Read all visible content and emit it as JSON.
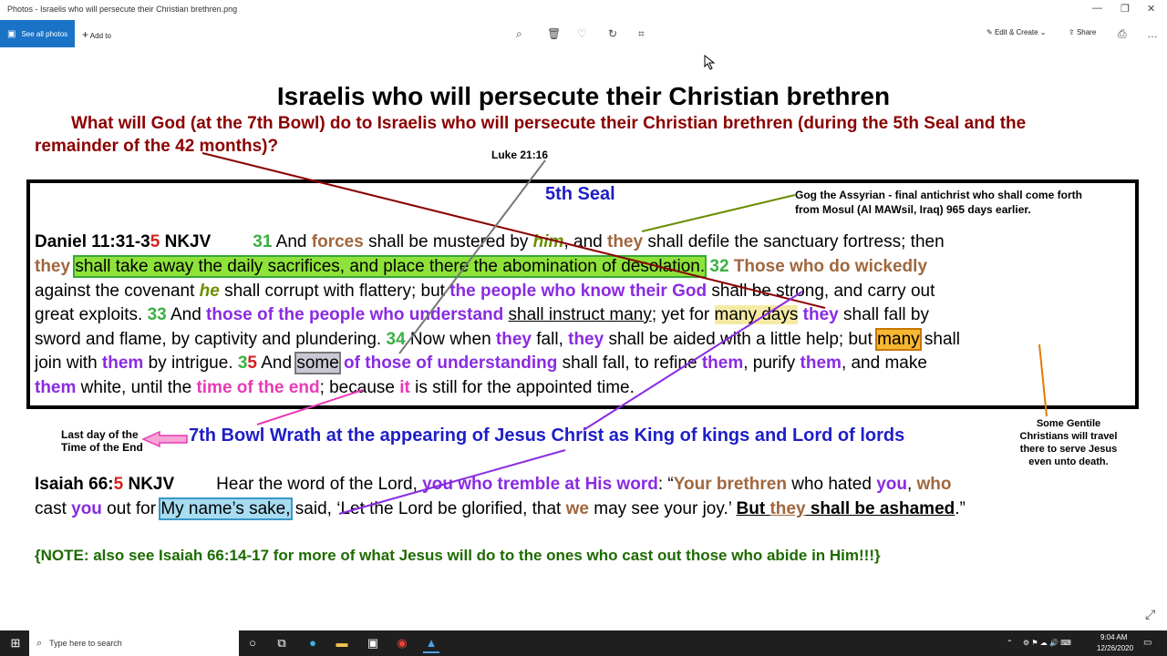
{
  "window": {
    "title": "Photos - Israelis who will persecute their Christian brethren.png",
    "controls": [
      "—",
      "❐",
      "✕"
    ]
  },
  "toolbar": {
    "see_all_label": "See all photos",
    "add_to_label": "Add to",
    "edit_create_label": "Edit & Create",
    "share_label": "Share",
    "icons": [
      "zoom-icon",
      "delete-icon",
      "heart-icon",
      "rotate-icon",
      "crop-icon",
      "print-icon",
      "more-icon"
    ]
  },
  "image": {
    "title": "Israelis who will persecute their Christian brethren",
    "question_1": "What will God (at the 7th Bowl) do to Israelis who will persecute their Christian brethren (during the 5th Seal and the",
    "question_2": "remainder of the 42 months)?",
    "luke_ref": "Luke 21:16",
    "seal_label": "5th Seal",
    "gog_note_1": "Gog the Assyrian - final antichrist who shall come forth",
    "gog_note_2": "from Mosul (Al MAWsil, Iraq) 965 days earlier.",
    "daniel": {
      "ref_a": "Daniel 11:31-3",
      "ref_b": "5",
      "ref_c": " NKJV",
      "line1": [
        {
          "t": "31",
          "c": "green"
        },
        {
          "t": " And ",
          "c": ""
        },
        {
          "t": "forces",
          "c": "tan"
        },
        {
          "t": " shall be mustered by ",
          "c": ""
        },
        {
          "t": "him",
          "c": "olive"
        },
        {
          "t": ", and ",
          "c": ""
        },
        {
          "t": "they",
          "c": "tan"
        },
        {
          "t": " shall defile the sanctuary fortress; then",
          "c": ""
        }
      ],
      "line2": [
        {
          "t": "they",
          "c": "tan"
        },
        {
          "t": " ",
          "c": ""
        },
        {
          "t": "shall take away the daily sacrifices, and place there the abomination of desolation.",
          "c": "hl-green"
        },
        {
          "t": " 32",
          "c": "green"
        },
        {
          "t": " Those who do wickedly",
          "c": "tan"
        }
      ],
      "line3": [
        {
          "t": "against the covenant ",
          "c": ""
        },
        {
          "t": "he",
          "c": "olive"
        },
        {
          "t": " shall corrupt with flattery; but ",
          "c": ""
        },
        {
          "t": "the people who know their God",
          "c": "purple"
        },
        {
          "t": " shall be strong, and carry out",
          "c": ""
        }
      ],
      "line4": [
        {
          "t": "great exploits. ",
          "c": ""
        },
        {
          "t": "33",
          "c": "green"
        },
        {
          "t": " And ",
          "c": ""
        },
        {
          "t": "those of the people who understand",
          "c": "purple"
        },
        {
          "t": " ",
          "c": ""
        },
        {
          "t": "shall instruct many",
          "c": "ul"
        },
        {
          "t": "; yet for ",
          "c": ""
        },
        {
          "t": "many days",
          "c": "hl-yellow"
        },
        {
          "t": " ",
          "c": ""
        },
        {
          "t": "they",
          "c": "purple"
        },
        {
          "t": " shall fall by",
          "c": ""
        }
      ],
      "line5": [
        {
          "t": "sword and flame, by captivity and plundering. ",
          "c": ""
        },
        {
          "t": "34",
          "c": "green"
        },
        {
          "t": " Now when ",
          "c": ""
        },
        {
          "t": "they",
          "c": "purple"
        },
        {
          "t": " fall, ",
          "c": ""
        },
        {
          "t": "they",
          "c": "purple"
        },
        {
          "t": " shall be aided with a little help; but ",
          "c": ""
        },
        {
          "t": "many",
          "c": "hl-orange"
        },
        {
          "t": " shall",
          "c": ""
        }
      ],
      "line6": [
        {
          "t": "join with ",
          "c": ""
        },
        {
          "t": "them",
          "c": "purple"
        },
        {
          "t": " by intrigue. ",
          "c": ""
        },
        {
          "t": "3",
          "c": "green"
        },
        {
          "t": "5",
          "c": "red"
        },
        {
          "t": " And ",
          "c": ""
        },
        {
          "t": "some",
          "c": "hl-gray"
        },
        {
          "t": " of those of understanding",
          "c": "purple"
        },
        {
          "t": " shall fall, to refine ",
          "c": ""
        },
        {
          "t": "them",
          "c": "purple"
        },
        {
          "t": ", purify ",
          "c": ""
        },
        {
          "t": "them",
          "c": "purple"
        },
        {
          "t": ", and make",
          "c": ""
        }
      ],
      "line7": [
        {
          "t": "them",
          "c": "purple"
        },
        {
          "t": " white, until the ",
          "c": ""
        },
        {
          "t": "time of the end",
          "c": "magenta"
        },
        {
          "t": "; because ",
          "c": ""
        },
        {
          "t": "it",
          "c": "magenta"
        },
        {
          "t": " is still for the appointed time.",
          "c": ""
        }
      ]
    },
    "last_day_1": "Last day of the",
    "last_day_2": "Time of the End",
    "bowl_wrath": "7th Bowl Wrath at the appearing of Jesus Christ as King of kings and Lord of lords",
    "gentile_note": [
      "Some Gentile",
      "Christians will travel",
      "there to serve Jesus",
      "even unto death."
    ],
    "isaiah": {
      "ref_a": "Isaiah 66:",
      "ref_b": "5",
      "ref_c": " NKJV",
      "line1": [
        {
          "t": "Hear the word of the Lord, ",
          "c": ""
        },
        {
          "t": "you who tremble at His word",
          "c": "purple"
        },
        {
          "t": ": “",
          "c": ""
        },
        {
          "t": "Your brethren",
          "c": "tan"
        },
        {
          "t": " who hated ",
          "c": ""
        },
        {
          "t": "you",
          "c": "purple"
        },
        {
          "t": ", ",
          "c": ""
        },
        {
          "t": "who",
          "c": "tan"
        }
      ],
      "line2": [
        {
          "t": "cast ",
          "c": ""
        },
        {
          "t": "you",
          "c": "purple"
        },
        {
          "t": " out for ",
          "c": ""
        },
        {
          "t": "My name’s sake,",
          "c": "hl-cyan"
        },
        {
          "t": " said, ‘Let the Lord be glorified, that ",
          "c": ""
        },
        {
          "t": "we",
          "c": "tan"
        },
        {
          "t": " may see your joy.’ ",
          "c": ""
        },
        {
          "t": "But ",
          "c": "b ul"
        },
        {
          "t": "they",
          "c": "tan ul"
        },
        {
          "t": " shall be ashamed",
          "c": "b ul"
        },
        {
          "t": ".”",
          "c": ""
        }
      ]
    },
    "note": "{NOTE: also see Isaiah 66:14-17 for more of what Jesus will do to the ones who cast out those who abide in Him!!!}"
  },
  "taskbar": {
    "search_placeholder": "Type here to search",
    "time": "9:04 AM",
    "date": "12/26/2020"
  }
}
